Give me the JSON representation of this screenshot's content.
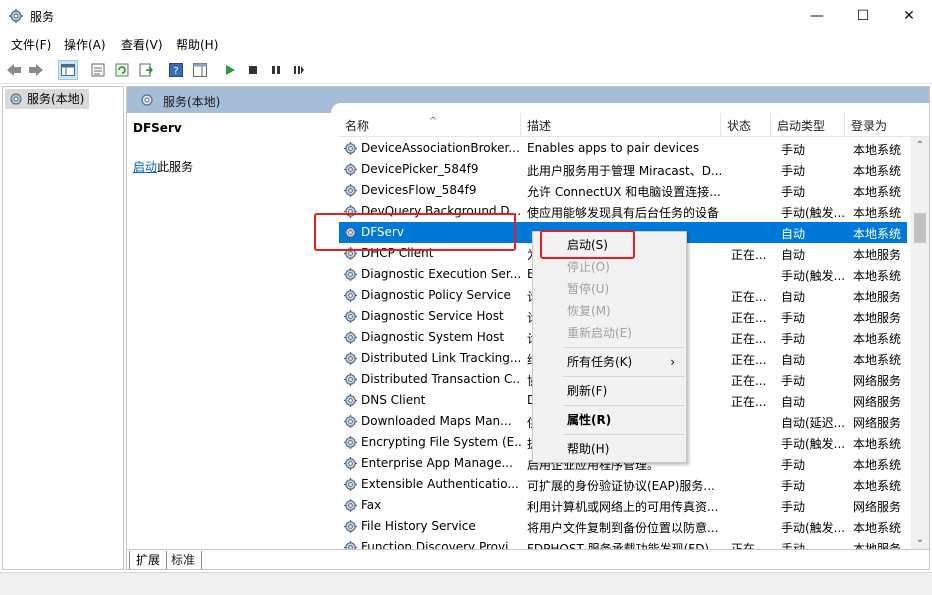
{
  "window": {
    "title": "服务",
    "controls": [
      "—",
      "☐",
      "✕"
    ]
  },
  "menu": [
    "文件(F)",
    "操作(A)",
    "查看(V)",
    "帮助(H)"
  ],
  "left_pane": {
    "tree_item": "服务(本地)"
  },
  "right_pane": {
    "header": "服务(本地)",
    "selected_service": "DFServ",
    "start_link": "启动",
    "start_suffix": "此服务"
  },
  "columns": [
    "名称",
    "描述",
    "状态",
    "启动类型",
    "登录为"
  ],
  "services": [
    {
      "name": "DeviceAssociationBroker...",
      "desc": "Enables apps to pair devices",
      "status": "",
      "start": "手动",
      "logon": "本地系统"
    },
    {
      "name": "DevicePicker_584f9",
      "desc": "此用户服务用于管理 Miracast、D...",
      "status": "",
      "start": "手动",
      "logon": "本地系统"
    },
    {
      "name": "DevicesFlow_584f9",
      "desc": "允许 ConnectUX 和电脑设置连接...",
      "status": "",
      "start": "手动",
      "logon": "本地系统"
    },
    {
      "name": "DevQuery Background D...",
      "desc": "使应用能够发现具有后台任务的设备",
      "status": "",
      "start": "手动(触发...",
      "logon": "本地系统"
    },
    {
      "name": "DFServ",
      "desc": "",
      "status": "",
      "start": "自动",
      "logon": "本地系统"
    },
    {
      "name": "DHCP Client",
      "desc": "为...",
      "status": "正在...",
      "start": "自动",
      "logon": "本地服务"
    },
    {
      "name": "Diagnostic Execution Ser...",
      "desc": "E...",
      "status": "",
      "start": "手动(触发...",
      "logon": "本地系统"
    },
    {
      "name": "Diagnostic Policy Service",
      "desc": "诊...",
      "status": "正在...",
      "start": "自动",
      "logon": "本地服务"
    },
    {
      "name": "Diagnostic Service Host",
      "desc": "诊...",
      "status": "正在...",
      "start": "手动",
      "logon": "本地服务"
    },
    {
      "name": "Diagnostic System Host",
      "desc": "诊...",
      "status": "正在...",
      "start": "手动",
      "logon": "本地系统"
    },
    {
      "name": "Distributed Link Tracking...",
      "desc": "维...",
      "status": "正在...",
      "start": "自动",
      "logon": "本地系统"
    },
    {
      "name": "Distributed Transaction C...",
      "desc": "协...",
      "status": "正在...",
      "start": "手动",
      "logon": "网络服务"
    },
    {
      "name": "DNS Client",
      "desc": "D...",
      "status": "正在...",
      "start": "自动",
      "logon": "网络服务"
    },
    {
      "name": "Downloaded Maps Man...",
      "desc": "供...",
      "status": "",
      "start": "自动(延迟...",
      "logon": "网络服务"
    },
    {
      "name": "Encrypting File System (E...",
      "desc": "提...",
      "status": "",
      "start": "手动(触发...",
      "logon": "本地系统"
    },
    {
      "name": "Enterprise App Manage...",
      "desc": "启用企业应用程序管理。",
      "status": "",
      "start": "手动",
      "logon": "本地系统"
    },
    {
      "name": "Extensible Authenticatio...",
      "desc": "可扩展的身份验证协议(EAP)服务...",
      "status": "",
      "start": "手动",
      "logon": "本地系统"
    },
    {
      "name": "Fax",
      "desc": "利用计算机或网络上的可用传真资...",
      "status": "",
      "start": "手动",
      "logon": "网络服务"
    },
    {
      "name": "File History Service",
      "desc": "将用户文件复制到备份位置以防意...",
      "status": "",
      "start": "手动(触发...",
      "logon": "本地系统"
    },
    {
      "name": "Function Discovery Provi...",
      "desc": "FDPHOST 服务承载功能发现(FD)...",
      "status": "正在...",
      "start": "手动",
      "logon": "本地服务"
    }
  ],
  "context_menu": {
    "items": [
      "启动(S)",
      "停止(O)",
      "暂停(U)",
      "恢复(M)",
      "重新启动(E)",
      "所有任务(K)",
      "刷新(F)",
      "属性(R)",
      "帮助(H)"
    ]
  },
  "tabs": [
    "扩展",
    "标准"
  ],
  "colors": {
    "selection": "#0078d7",
    "header_band": "#a6bdd7",
    "highlight_box": "#e0201e"
  }
}
